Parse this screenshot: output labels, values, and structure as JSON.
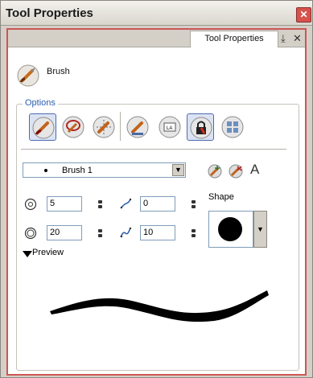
{
  "window": {
    "title": "Tool Properties"
  },
  "tab": {
    "label": "Tool Properties"
  },
  "tool": {
    "name": "Brush"
  },
  "options": {
    "legend": "Options"
  },
  "brush_select": {
    "value": "Brush 1"
  },
  "fields": {
    "min_size": "5",
    "max_size": "20",
    "smoothness": "0",
    "contour": "10"
  },
  "shape": {
    "label": "Shape"
  },
  "preview": {
    "label": "Preview"
  },
  "text_tool": {
    "label": "A"
  },
  "colors": {
    "accent_border": "#cc5656",
    "selected_tool": "#4d6bb0",
    "legend_blue": "#2a5db0"
  }
}
